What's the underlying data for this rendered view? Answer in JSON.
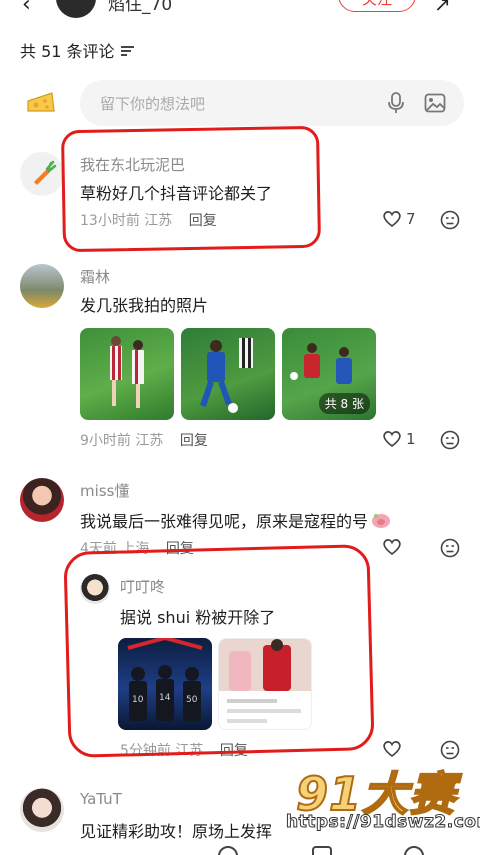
{
  "header": {
    "back_icon": "chevron-left-icon",
    "author_name": "焰住_70",
    "follow_label": "关注",
    "share_icon": "share-icon"
  },
  "comments_header": {
    "count_label": "共 51 条评论",
    "sort_icon": "sort-icon"
  },
  "input": {
    "placeholder": "留下你的想法吧",
    "mic_icon": "microphone-icon",
    "image_icon": "image-icon"
  },
  "comments": [
    {
      "user": "我在东北玩泥巴",
      "text": "草粉好几个抖音评论都关了",
      "time": "13小时前",
      "location": "江苏",
      "reply_label": "回复",
      "likes": "7"
    },
    {
      "user": "霜林",
      "text": "发几张我拍的照片",
      "time": "9小时前",
      "location": "江苏",
      "reply_label": "回复",
      "likes": "1",
      "photo_badge": "共 8 张"
    },
    {
      "user": "miss懂",
      "text": "我说最后一张难得见呢，原来是寇程的号",
      "time": "4天前",
      "location": "上海",
      "reply_label": "回复",
      "likes": ""
    },
    {
      "user": "YaTuT",
      "text": "见证精彩助攻！原场上发挥",
      "time": "",
      "location": "",
      "reply_label": "",
      "likes": ""
    }
  ],
  "reply": {
    "user": "叮叮咚",
    "text": "据说 shui 粉被开除了",
    "time": "5分钟前",
    "location": "江苏",
    "reply_label": "回复",
    "likes": ""
  },
  "watermark": {
    "brand": "91大赛",
    "url": "https://91dswz2.com"
  },
  "colors": {
    "accent": "#e8413c",
    "annotation_red": "#e21b1b",
    "muted": "#9a9a9a"
  }
}
